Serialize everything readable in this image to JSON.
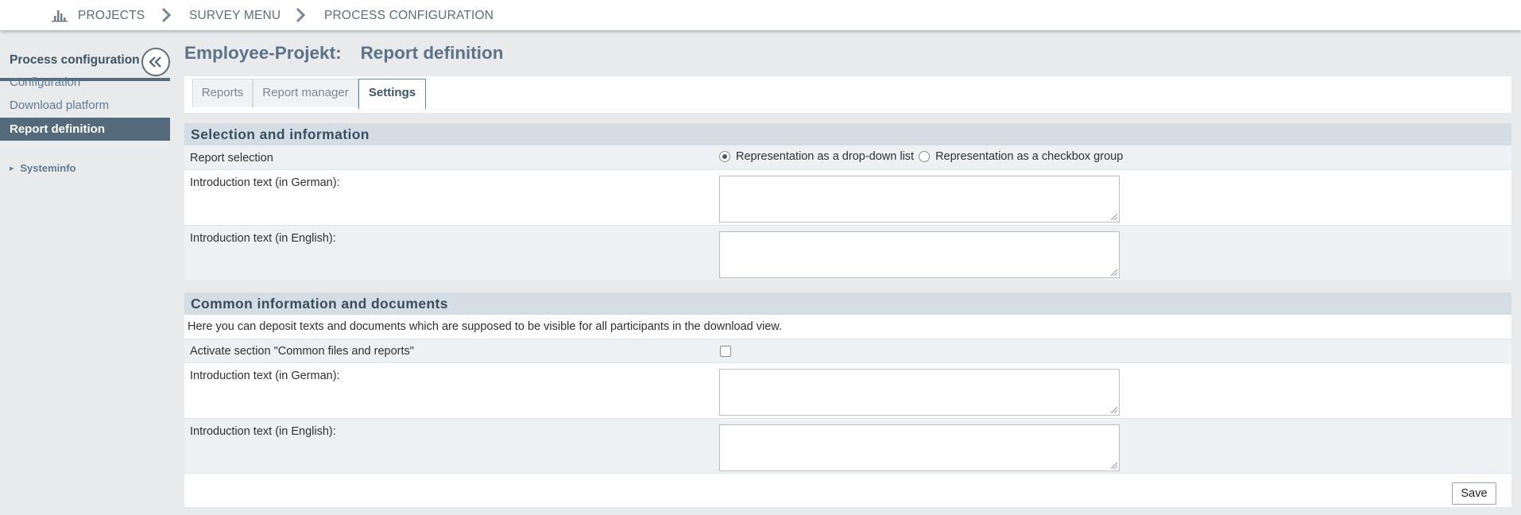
{
  "breadcrumb": {
    "items": [
      "PROJECTS",
      "SURVEY MENU",
      "PROCESS CONFIGURATION"
    ]
  },
  "sidebar": {
    "title": "Process configuration",
    "items": [
      {
        "label": "Configuration",
        "active": false
      },
      {
        "label": "Download platform",
        "active": false
      },
      {
        "label": "Report definition",
        "active": true
      }
    ],
    "systeminfo": "Systeminfo"
  },
  "page": {
    "project": "Employee-Projekt:",
    "title": "Report definition"
  },
  "tabs": [
    {
      "label": "Reports",
      "active": false
    },
    {
      "label": "Report manager",
      "active": false
    },
    {
      "label": "Settings",
      "active": true
    }
  ],
  "section1": {
    "heading": "Selection and information",
    "report_selection_label": "Report selection",
    "option_dropdown": "Representation as a drop-down list",
    "option_checkbox": "Representation as a checkbox group",
    "selected_option": "dropdown",
    "intro_german_label": "Introduction text (in German):",
    "intro_english_label": "Introduction text (in English):",
    "intro_german_value": "",
    "intro_english_value": ""
  },
  "section2": {
    "heading": "Common information and documents",
    "description": "Here you can deposit texts and documents which are supposed to be visible for all participants in the download view.",
    "activate_label": "Activate section \"Common files and reports\"",
    "activate_checked": false,
    "intro_german_label": "Introduction text (in German):",
    "intro_english_label": "Introduction text (in English):",
    "intro_german_value": "",
    "intro_english_value": ""
  },
  "save_label": "Save",
  "colors": {
    "accent": "#556a7a",
    "section_bg": "#d4dde4",
    "title": "#5a7388"
  }
}
